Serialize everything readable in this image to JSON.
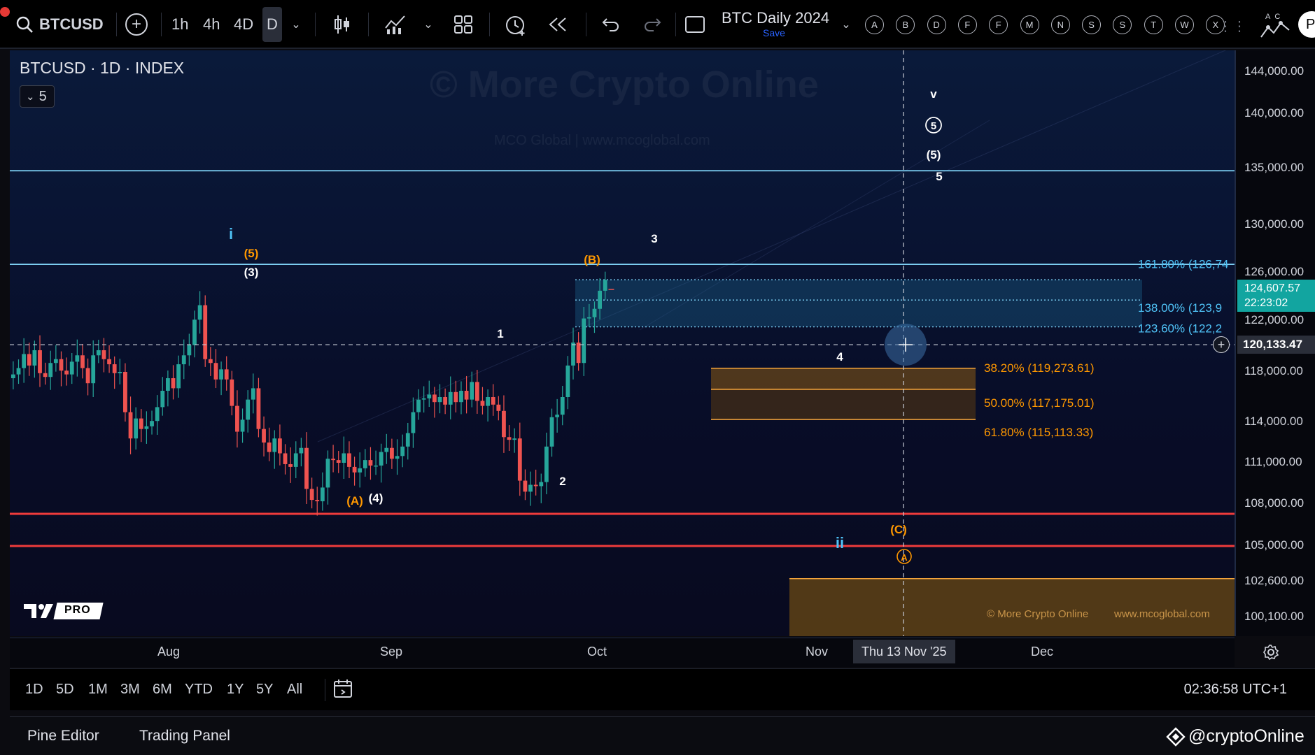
{
  "toolbar": {
    "symbol": "BTCUSD",
    "intervals": [
      "1h",
      "4h",
      "4D",
      "D"
    ],
    "layout_name": "BTC Daily 2024",
    "save_label": "Save",
    "alpha_buttons": [
      "A",
      "B",
      "D",
      "F",
      "F",
      "M",
      "N",
      "S",
      "S",
      "T",
      "W",
      "X"
    ],
    "right_tag": "AC",
    "profile_initial": "P"
  },
  "legend": {
    "title": "BTCUSD · 1D · INDEX",
    "collapse_count": "5"
  },
  "watermark": {
    "main": "© More Crypto Online",
    "sub": "MCO Global   |   www.mcoglobal.com",
    "footer_left": "© More Crypto Online",
    "footer_right": "www.mcoglobal.com"
  },
  "chart_data": {
    "type": "candlestick",
    "symbol": "BTCUSD",
    "interval": "1D",
    "ylim": [
      99000,
      146000
    ],
    "x_ticks": [
      "Aug",
      "Sep",
      "Oct",
      "Nov",
      "Dec"
    ],
    "y_ticks": [
      144000,
      140000,
      135000,
      130000,
      126000,
      122000,
      118000,
      114000,
      111000,
      108000,
      105000,
      102600,
      100100
    ],
    "last_price": 124607.57,
    "countdown": "22:23:02",
    "crosshair": {
      "price": 120133.47,
      "date": "Thu 13 Nov '25"
    },
    "closes": [
      117800,
      118300,
      119400,
      118500,
      119700,
      117900,
      117600,
      118700,
      119000,
      118100,
      117800,
      118800,
      119300,
      118300,
      117100,
      119300,
      119700,
      119000,
      118600,
      117900,
      118000,
      114800,
      112800,
      114300,
      113500,
      113700,
      114100,
      115200,
      116500,
      117500,
      116700,
      118600,
      119300,
      120100,
      122100,
      123300,
      119000,
      118700,
      117400,
      118200,
      117400,
      115300,
      113300,
      114200,
      115800,
      116700,
      113500,
      112500,
      111800,
      112800,
      111700,
      110900,
      110700,
      111700,
      112100,
      109100,
      108300,
      108200,
      109200,
      111300,
      111200,
      111000,
      111700,
      110700,
      110300,
      110600,
      111200,
      110800,
      110800,
      111800,
      112100,
      111300,
      111500,
      112200,
      113200,
      114800,
      115800,
      115900,
      116200,
      115600,
      116000,
      115400,
      116400,
      115600,
      116500,
      115800,
      117200,
      115700,
      115300,
      116000,
      115400,
      114900,
      112900,
      112700,
      112800,
      109700,
      108900,
      109400,
      109300,
      109600,
      112200,
      114400,
      114600,
      116000,
      118500,
      120300,
      118700,
      122200,
      122300,
      123000,
      124500,
      125400
    ],
    "levels": [
      {
        "label": "161.80% (126,74",
        "price": 126740,
        "color": "#4fc3f7"
      },
      {
        "label": "138.00% (123,9",
        "price": 123900,
        "color": "#4fc3f7"
      },
      {
        "label": "123.60% (122,2",
        "price": 122200,
        "color": "#4fc3f7"
      },
      {
        "label": "38.20% (119,273.61)",
        "price": 119273.61,
        "color": "#ff9800"
      },
      {
        "label": "50.00% (117,175.01)",
        "price": 117175.01,
        "color": "#ff9800"
      },
      {
        "label": "61.80% (115,113.33)",
        "price": 115113.33,
        "color": "#ff9800"
      }
    ],
    "support_lines": [
      107300,
      105000
    ],
    "resistance_lines": [
      134800,
      126700
    ],
    "wave_labels": [
      {
        "text": "i",
        "color": "#4fc3f7"
      },
      {
        "text": "(5)",
        "color": "#ff9800"
      },
      {
        "text": "(3)",
        "color": "#ffffff"
      },
      {
        "text": "(B)",
        "color": "#ff9800"
      },
      {
        "text": "3",
        "color": "#ffffff"
      },
      {
        "text": "1",
        "color": "#ffffff"
      },
      {
        "text": "4",
        "color": "#ffffff"
      },
      {
        "text": "2",
        "color": "#ffffff"
      },
      {
        "text": "(A)",
        "color": "#ff9800"
      },
      {
        "text": "(4)",
        "color": "#ffffff"
      },
      {
        "text": "(C)",
        "color": "#ff9800"
      },
      {
        "text": "ii",
        "color": "#4fc3f7"
      },
      {
        "text": "v",
        "color": "#ffffff"
      },
      {
        "text": "5",
        "color": "#ffffff"
      },
      {
        "text": "(5)",
        "color": "#ffffff"
      },
      {
        "text": "5",
        "color": "#ffffff"
      },
      {
        "text": "A",
        "color": "#ff9800"
      }
    ],
    "up_color": "#26a69a",
    "down_color": "#ef5350"
  },
  "time_ranges": [
    "1D",
    "5D",
    "1M",
    "3M",
    "6M",
    "YTD",
    "1Y",
    "5Y",
    "All"
  ],
  "clock": "02:36:58 UTC+1",
  "panels": [
    "Pine Editor",
    "Trading Panel"
  ],
  "brand_handle": "@cryptoOnline",
  "pro_badge": "PRO"
}
